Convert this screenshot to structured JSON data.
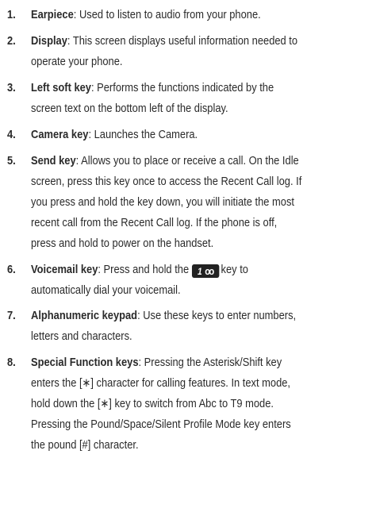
{
  "items": [
    {
      "num": "1.",
      "term": "Earpiece",
      "text": ": Used to listen to audio from your phone."
    },
    {
      "num": "2.",
      "term": "Display",
      "text": ": This screen displays useful information needed to",
      "cont": [
        "operate your phone."
      ]
    },
    {
      "num": "3.",
      "term": "Left soft key",
      "text": ": Performs the functions indicated by the",
      "cont": [
        "screen text on the bottom left of the display."
      ]
    },
    {
      "num": "4.",
      "term": "Camera key",
      "text": ": Launches the Camera."
    },
    {
      "num": "5.",
      "term": "Send key",
      "text": ": Allows you to place or receive a call. On the Idle",
      "cont": [
        "screen, press this key once to access the Recent Call log. If",
        "you press and hold the key down, you will initiate the most",
        "recent call from the Recent Call log. If the phone is off,",
        "press and hold to power on the handset."
      ]
    },
    {
      "num": "6.",
      "term": "Voicemail key",
      "text_before_key": ": Press and hold the",
      "key_digit": "1",
      "key_symbol": "oo",
      "text_after_key": "key to",
      "cont": [
        "automatically dial your voicemail."
      ]
    },
    {
      "num": "7.",
      "term": "Alphanumeric keypad",
      "text": ": Use these keys to enter numbers,",
      "cont": [
        "letters and characters."
      ]
    },
    {
      "num": "8.",
      "term": "Special Function keys",
      "text": ": Pressing the Asterisk/Shift key",
      "cont": [
        "enters the [∗] character for calling features.  In text mode,",
        "hold down the [∗] key to switch from Abc to T9 mode.",
        "Pressing the Pound/Space/Silent Profile Mode key enters",
        "the pound [#] character."
      ]
    }
  ]
}
